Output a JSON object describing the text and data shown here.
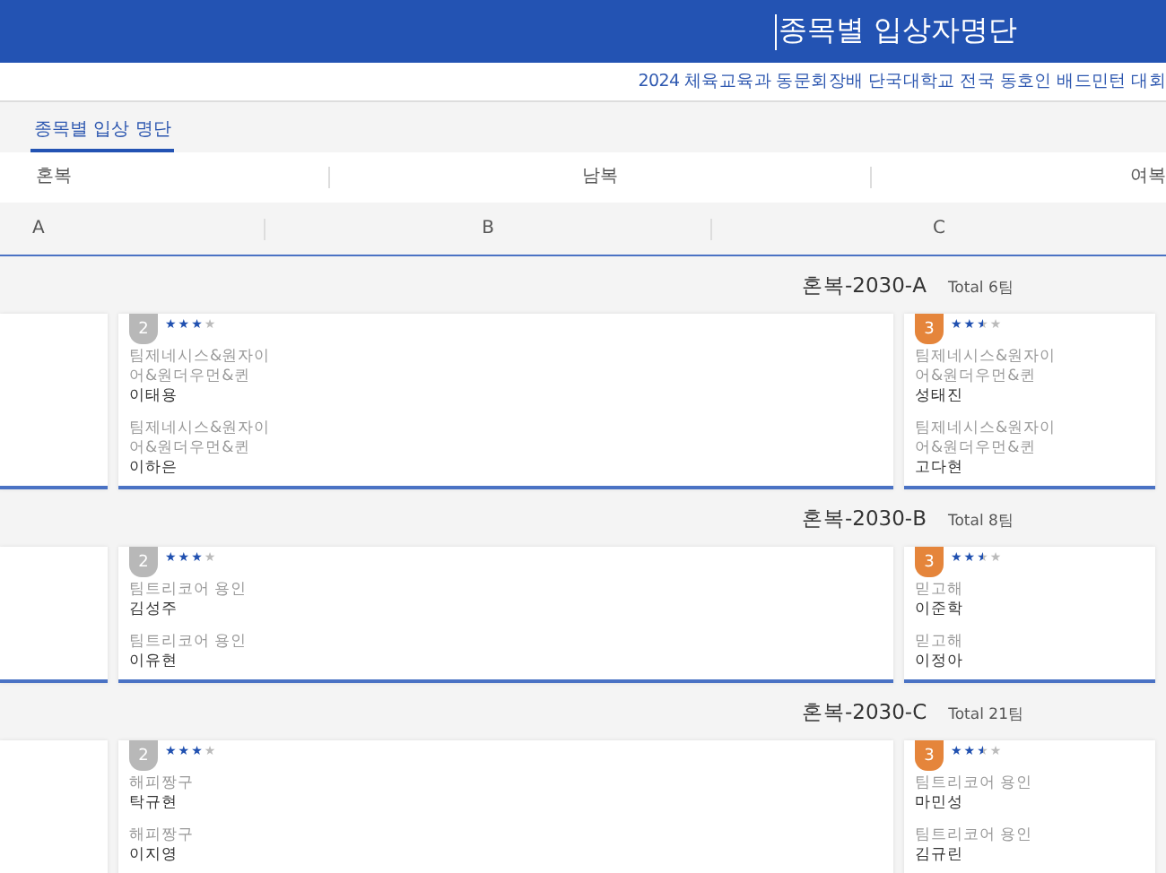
{
  "header": {
    "title": "종목별 입상자명단",
    "subtitle": "2024 체육교육과 동문회장배 단국대학교 전국 동호인 배드민턴 대회"
  },
  "tabs": [
    {
      "label": "종목별 입상 명단",
      "selected": true
    }
  ],
  "categories": [
    "혼복",
    "남복",
    "여복"
  ],
  "divisions": [
    "A",
    "B",
    "C"
  ],
  "groups": [
    {
      "title": "혼복-2030-A",
      "total": "Total 6팀",
      "cards": [
        {
          "kind": "empty"
        },
        {
          "kind": "medal",
          "color": "#b8b8b8",
          "rank": "2",
          "stars": 3,
          "entries": [
            {
              "team": "팀제네시스&원자이어&원더우먼&퀸",
              "player": "이태용"
            },
            {
              "team": "팀제네시스&원자이어&원더우먼&퀸",
              "player": "이하은"
            }
          ]
        },
        {
          "kind": "medal",
          "color": "#e5853b",
          "rank": "3",
          "stars": 2.5,
          "entries": [
            {
              "team": "팀제네시스&원자이어&원더우먼&퀸",
              "player": "성태진"
            },
            {
              "team": "팀제네시스&원자이어&원더우먼&퀸",
              "player": "고다현"
            }
          ]
        }
      ]
    },
    {
      "title": "혼복-2030-B",
      "total": "Total 8팀",
      "cards": [
        {
          "kind": "empty"
        },
        {
          "kind": "medal",
          "color": "#b8b8b8",
          "rank": "2",
          "stars": 3,
          "entries": [
            {
              "team": "팀트리코어 용인",
              "player": "김성주"
            },
            {
              "team": "팀트리코어 용인",
              "player": "이유현"
            }
          ]
        },
        {
          "kind": "medal",
          "color": "#e5853b",
          "rank": "3",
          "stars": 2.5,
          "entries": [
            {
              "team": "믿고해",
              "player": "이준학"
            },
            {
              "team": "믿고해",
              "player": "이정아"
            }
          ]
        }
      ]
    },
    {
      "title": "혼복-2030-C",
      "total": "Total 21팀",
      "cards": [
        {
          "kind": "empty"
        },
        {
          "kind": "medal",
          "color": "#b8b8b8",
          "rank": "2",
          "stars": 3,
          "entries": [
            {
              "team": "해피짱구",
              "player": "탁규현"
            },
            {
              "team": "해피짱구",
              "player": "이지영"
            }
          ]
        },
        {
          "kind": "medal",
          "color": "#e5853b",
          "rank": "3",
          "stars": 2.5,
          "entries": [
            {
              "team": "팀트리코어 용인",
              "player": "마민성"
            },
            {
              "team": "팀트리코어 용인",
              "player": "김규린"
            }
          ]
        }
      ]
    }
  ]
}
